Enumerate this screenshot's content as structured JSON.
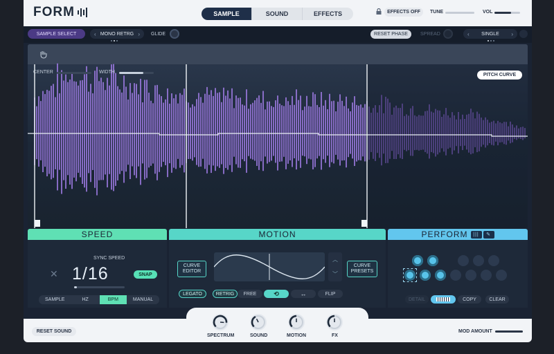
{
  "app": {
    "logo": "FORM",
    "tabs": [
      {
        "label": "SAMPLE",
        "active": true
      },
      {
        "label": "SOUND",
        "active": false
      },
      {
        "label": "EFFECTS",
        "active": false
      }
    ],
    "effects_off_label": "EFFECTS OFF",
    "tune_label": "TUNE",
    "tune_value": 0.5,
    "vol_label": "VOL",
    "vol_value": 0.65
  },
  "sample_bar": {
    "sample_select_label": "SAMPLE SELECT",
    "mode_label": "MONO RETRG",
    "glide_label": "GLIDE",
    "reset_phase_label": "RESET PHASE",
    "spread_label": "SPREAD",
    "voice_mode_label": "SINGLE",
    "center_label": "CENTER",
    "width_label": "WIDTH",
    "pitch_curve_label": "PITCH CURVE"
  },
  "sections": {
    "speed": "SPEED",
    "motion": "MOTION",
    "perform": "PERFORM"
  },
  "speed": {
    "sync_label": "SYNC SPEED",
    "value": "1/16",
    "snap_label": "SNAP",
    "modes": [
      {
        "label": "SAMPLE",
        "active": false
      },
      {
        "label": "HZ",
        "active": false
      },
      {
        "label": "BPM",
        "active": true
      },
      {
        "label": "MANUAL",
        "active": false
      }
    ]
  },
  "motion": {
    "curve_editor_label": "CURVE EDITOR",
    "curve_presets_label": "CURVE PRESETS",
    "legato_label": "LEGATO",
    "retrig_label": "RETRIG",
    "free_label": "FREE",
    "flip_label": "FLIP"
  },
  "perform": {
    "detail_label": "DETAIL",
    "copy_label": "COPY",
    "clear_label": "CLEAR"
  },
  "bottom": {
    "reset_sound_label": "RESET SOUND",
    "knobs": [
      {
        "label": "SPECTRUM",
        "value": 0.85
      },
      {
        "label": "SOUND",
        "value": 0.4
      },
      {
        "label": "MOTION",
        "value": 0.5
      },
      {
        "label": "FX",
        "value": 0.5
      }
    ],
    "mod_amount_label": "MOD AMOUNT"
  },
  "colors": {
    "accent_teal": "#5fe0b4",
    "accent_blue": "#62c6ee",
    "wave_purple": "#9a6fe0"
  },
  "icons": [
    "lock-icon",
    "hand-cursor-icon",
    "close-icon",
    "loop-icon",
    "ping-pong-icon",
    "piano-keys-icon",
    "wrench-icon",
    "bars-icon"
  ]
}
